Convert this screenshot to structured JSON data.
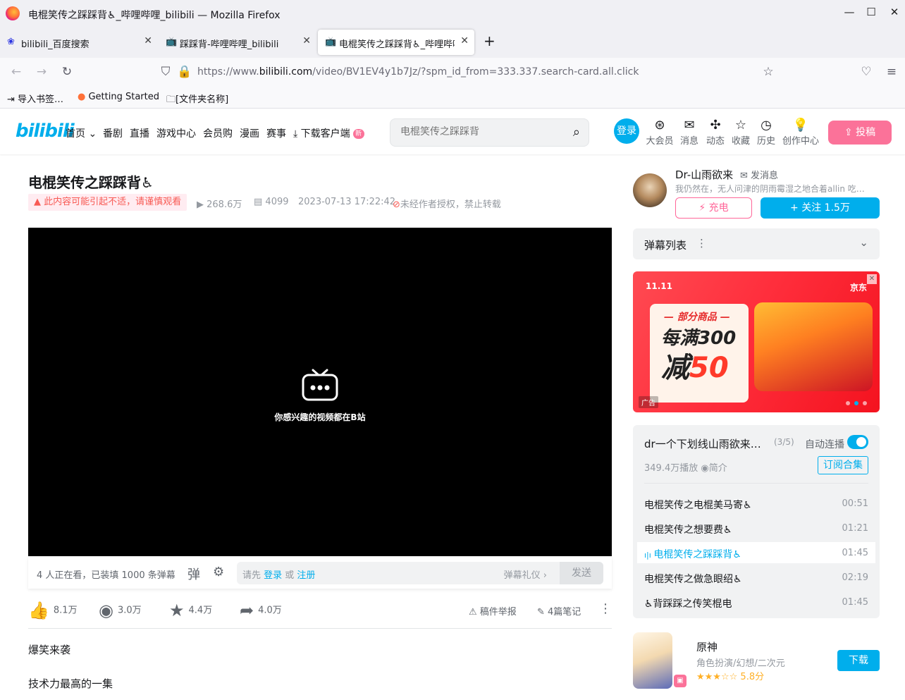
{
  "browser": {
    "window_title": "电棍笑传之踩踩背♿_哔哩哔哩_bilibili — Mozilla Firefox",
    "tabs": [
      {
        "label": "bilibili_百度搜索",
        "icon": "baidu-paw-icon"
      },
      {
        "label": "踩踩背-哔哩哔哩_bilibili",
        "icon": "bilibili-tv-icon"
      },
      {
        "label": "电棍笑传之踩踩背♿_哔哩哔哩",
        "icon": "bilibili-tv-icon"
      }
    ],
    "new_tab": "+",
    "url_prefix": "https://www.",
    "url_domain": "bilibili.com",
    "url_rest": "/video/BV1EV4y1b7Jz/?spm_id_from=333.337.search-card.all.click",
    "bookmarks": [
      "导入书签…",
      "Getting Started",
      "[文件夹名称]"
    ]
  },
  "site": {
    "logo": "bilibili",
    "nav": [
      "首页",
      "番剧",
      "直播",
      "游戏中心",
      "会员购",
      "漫画",
      "赛事",
      "下载客户端"
    ],
    "new_badge": "新",
    "search_placeholder": "电棍笑传之踩踩背",
    "login": "登录",
    "header_icons": [
      {
        "label": "大会员",
        "icon": "vip-icon"
      },
      {
        "label": "消息",
        "icon": "message-icon"
      },
      {
        "label": "动态",
        "icon": "dynamic-icon"
      },
      {
        "label": "收藏",
        "icon": "favorite-icon"
      },
      {
        "label": "历史",
        "icon": "history-icon"
      },
      {
        "label": "创作中心",
        "icon": "creator-icon"
      }
    ],
    "upload": "投稿"
  },
  "video": {
    "title": "电棍笑传之踩踩背♿",
    "warning": "此内容可能引起不适，请谨慎观看",
    "views": "268.6万",
    "danmaku": "4099",
    "date": "2023-07-13 17:22:42",
    "copyright": "未经作者授权，禁止转载",
    "player_text": "你感兴趣的视频都在B站",
    "watching": "4 人正在看，已装填 1000 条弹幕",
    "dm_placeholder_pre": "请先 ",
    "dm_login": "登录",
    "dm_or": " 或 ",
    "dm_register": "注册",
    "dm_etiquette": "弹幕礼仪 ›",
    "dm_send": "发送",
    "likes": "8.1万",
    "coins": "3.0万",
    "favorites": "4.4万",
    "shares": "4.0万",
    "report": "稿件举报",
    "notes": "4篇笔记",
    "desc_lines": [
      "爆笑来袭",
      "技术力最高的一集"
    ]
  },
  "uploader": {
    "name": "Dr-山雨欲来",
    "message": "发消息",
    "signature": "我仍然在，无人问津的阴雨霉湿之地合着allin 吃…",
    "charge": "充电",
    "follow": "+ 关注 1.5万"
  },
  "danmaku_list": {
    "label": "弹幕列表"
  },
  "ad": {
    "tag": "11.11",
    "brand": "京东",
    "sub": "— 部分商品 —",
    "line1": "每满300",
    "line2_pre": "减",
    "line2_num": "50",
    "label": "广告"
  },
  "playlist": {
    "title": "dr一个下划线山雨欲来…",
    "count": "(3/5)",
    "autoplay": "自动连播",
    "plays": "349.4万播放",
    "intro": "简介",
    "subscribe": "订阅合集",
    "items": [
      {
        "title": "电棍笑传之电棍美马寄♿",
        "duration": "00:51"
      },
      {
        "title": "电棍笑传之想要费♿",
        "duration": "01:21"
      },
      {
        "title": "电棍笑传之踩踩背♿",
        "duration": "01:45"
      },
      {
        "title": "电棍笑传之做急眼绍♿",
        "duration": "02:19"
      },
      {
        "title": "♿背踩踩之传笑棍电",
        "duration": "01:45"
      }
    ]
  },
  "game": {
    "name": "原神",
    "category": "角色扮演/幻想/二次元",
    "stars": "★★★☆☆",
    "score": "5.8分",
    "download": "下载"
  }
}
